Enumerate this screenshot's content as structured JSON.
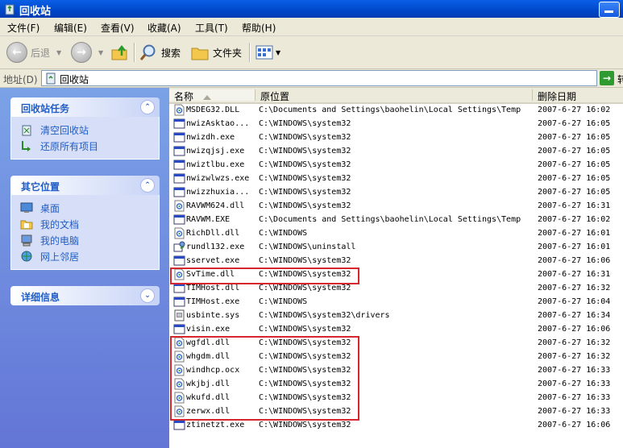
{
  "window": {
    "title": "回收站"
  },
  "menu": [
    "文件(F)",
    "编辑(E)",
    "查看(V)",
    "收藏(A)",
    "工具(T)",
    "帮助(H)"
  ],
  "toolbar": {
    "back": "后退",
    "search": "搜索",
    "folders": "文件夹"
  },
  "address": {
    "label": "地址(D)",
    "value": "回收站",
    "go": "转"
  },
  "panels": {
    "tasks": {
      "title": "回收站任务",
      "items": [
        "清空回收站",
        "还原所有项目"
      ]
    },
    "places": {
      "title": "其它位置",
      "items": [
        "桌面",
        "我的文档",
        "我的电脑",
        "网上邻居"
      ]
    },
    "details": {
      "title": "详细信息"
    }
  },
  "columns": {
    "name": "名称",
    "location": "原位置",
    "deleted": "删除日期"
  },
  "files": [
    {
      "name": "MSDEG32.DLL",
      "location": "C:\\Documents and Settings\\baohelin\\Local Settings\\Temp",
      "deleted": "2007-6-27 16:02",
      "icon": "dll-icon"
    },
    {
      "name": "nwizAsktao...",
      "location": "C:\\WINDOWS\\system32",
      "deleted": "2007-6-27 16:05",
      "icon": "exe-icon"
    },
    {
      "name": "nwizdh.exe",
      "location": "C:\\WINDOWS\\system32",
      "deleted": "2007-6-27 16:05",
      "icon": "exe-icon"
    },
    {
      "name": "nwizqjsj.exe",
      "location": "C:\\WINDOWS\\system32",
      "deleted": "2007-6-27 16:05",
      "icon": "exe-icon"
    },
    {
      "name": "nwiztlbu.exe",
      "location": "C:\\WINDOWS\\system32",
      "deleted": "2007-6-27 16:05",
      "icon": "exe-icon"
    },
    {
      "name": "nwizwlwzs.exe",
      "location": "C:\\WINDOWS\\system32",
      "deleted": "2007-6-27 16:05",
      "icon": "exe-icon"
    },
    {
      "name": "nwizzhuxia...",
      "location": "C:\\WINDOWS\\system32",
      "deleted": "2007-6-27 16:05",
      "icon": "exe-icon"
    },
    {
      "name": "RAVWM624.dll",
      "location": "C:\\WINDOWS\\system32",
      "deleted": "2007-6-27 16:31",
      "icon": "dll-icon"
    },
    {
      "name": "RAVWM.EXE",
      "location": "C:\\Documents and Settings\\baohelin\\Local Settings\\Temp",
      "deleted": "2007-6-27 16:02",
      "icon": "exe-icon"
    },
    {
      "name": "RichDll.dll",
      "location": "C:\\WINDOWS",
      "deleted": "2007-6-27 16:01",
      "icon": "dll-icon"
    },
    {
      "name": "rundl132.exe",
      "location": "C:\\WINDOWS\\uninstall",
      "deleted": "2007-6-27 16:01",
      "icon": "setup-icon"
    },
    {
      "name": "sservet.exe",
      "location": "C:\\WINDOWS\\system32",
      "deleted": "2007-6-27 16:06",
      "icon": "exe-icon"
    },
    {
      "name": "SvTime.dll",
      "location": "C:\\WINDOWS\\system32",
      "deleted": "2007-6-27 16:31",
      "icon": "dll-icon"
    },
    {
      "name": "TIMHost.dll",
      "location": "C:\\WINDOWS\\system32",
      "deleted": "2007-6-27 16:32",
      "icon": "exe-icon"
    },
    {
      "name": "TIMHost.exe",
      "location": "C:\\WINDOWS",
      "deleted": "2007-6-27 16:04",
      "icon": "exe-icon"
    },
    {
      "name": "usbinte.sys",
      "location": "C:\\WINDOWS\\system32\\drivers",
      "deleted": "2007-6-27 16:34",
      "icon": "sys-icon"
    },
    {
      "name": "visin.exe",
      "location": "C:\\WINDOWS\\system32",
      "deleted": "2007-6-27 16:06",
      "icon": "exe-icon"
    },
    {
      "name": "wgfdl.dll",
      "location": "C:\\WINDOWS\\system32",
      "deleted": "2007-6-27 16:32",
      "icon": "dll-icon"
    },
    {
      "name": "whgdm.dll",
      "location": "C:\\WINDOWS\\system32",
      "deleted": "2007-6-27 16:32",
      "icon": "dll-icon"
    },
    {
      "name": "windhcp.ocx",
      "location": "C:\\WINDOWS\\system32",
      "deleted": "2007-6-27 16:33",
      "icon": "dll-icon"
    },
    {
      "name": "wkjbj.dll",
      "location": "C:\\WINDOWS\\system32",
      "deleted": "2007-6-27 16:33",
      "icon": "dll-icon"
    },
    {
      "name": "wkufd.dll",
      "location": "C:\\WINDOWS\\system32",
      "deleted": "2007-6-27 16:33",
      "icon": "dll-icon"
    },
    {
      "name": "zerwx.dll",
      "location": "C:\\WINDOWS\\system32",
      "deleted": "2007-6-27 16:33",
      "icon": "dll-icon"
    },
    {
      "name": "ztinetzt.exe",
      "location": "C:\\WINDOWS\\system32",
      "deleted": "2007-6-27 16:06",
      "icon": "exe-icon"
    }
  ],
  "colors": {
    "highlight": "#d8262e",
    "link": "#215dc6",
    "titlebar": "#0a5fe6"
  }
}
